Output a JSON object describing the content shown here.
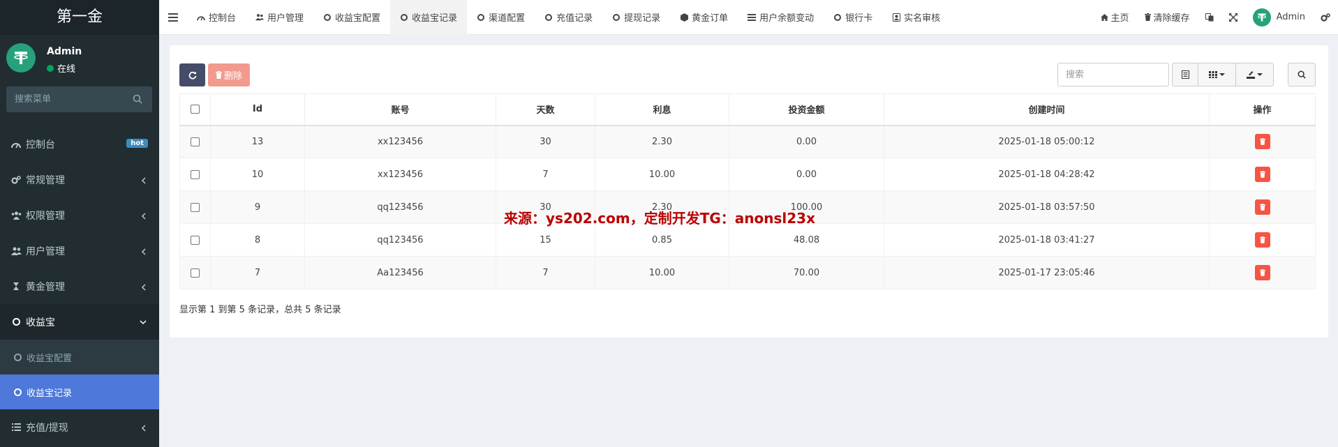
{
  "brand": {
    "title": "第一金",
    "accent": "#4e78d9",
    "sidebar_bg": "#222d32"
  },
  "user": {
    "name": "Admin",
    "status": "在线"
  },
  "menu_search": {
    "placeholder": "搜索菜单"
  },
  "sidebar": {
    "items": [
      {
        "label": "控制台",
        "icon": "dashboard-icon",
        "badge": "hot"
      },
      {
        "label": "常规管理",
        "icon": "cogs-icon"
      },
      {
        "label": "权限管理",
        "icon": "group-icon"
      },
      {
        "label": "用户管理",
        "icon": "users-icon"
      },
      {
        "label": "黄金管理",
        "icon": "hourglass-icon"
      },
      {
        "label": "收益宝",
        "icon": "circle-o-icon",
        "expanded": true,
        "children": [
          {
            "label": "收益宝配置",
            "active": false
          },
          {
            "label": "收益宝记录",
            "active": true
          }
        ]
      },
      {
        "label": "充值/提现",
        "icon": "list-icon"
      }
    ]
  },
  "tabs": [
    {
      "label": "控制台",
      "icon": "dashboard-icon"
    },
    {
      "label": "用户管理",
      "icon": "users-icon"
    },
    {
      "label": "收益宝配置",
      "icon": "circle-o-icon"
    },
    {
      "label": "收益宝记录",
      "icon": "circle-o-icon",
      "active": true
    },
    {
      "label": "渠道配置",
      "icon": "circle-o-icon"
    },
    {
      "label": "充值记录",
      "icon": "circle-o-icon"
    },
    {
      "label": "提现记录",
      "icon": "circle-o-icon"
    },
    {
      "label": "黄金订单",
      "icon": "cube-icon"
    },
    {
      "label": "用户余额变动",
      "icon": "list-icon"
    },
    {
      "label": "银行卡",
      "icon": "circle-o-icon"
    },
    {
      "label": "实名审核",
      "icon": "id-card-icon"
    }
  ],
  "topbar_right": {
    "home": "主页",
    "clear_cache": "清除缓存",
    "admin": "Admin"
  },
  "toolbar": {
    "delete_label": "删除",
    "search_placeholder": "搜索"
  },
  "table": {
    "columns": [
      "Id",
      "账号",
      "天数",
      "利息",
      "投资金额",
      "创建时间",
      "操作"
    ],
    "rows": [
      {
        "id": "13",
        "account": "xx123456",
        "days": "30",
        "interest": "2.30",
        "amount": "0.00",
        "created": "2025-01-18 05:00:12"
      },
      {
        "id": "10",
        "account": "xx123456",
        "days": "7",
        "interest": "10.00",
        "amount": "0.00",
        "created": "2025-01-18 04:28:42"
      },
      {
        "id": "9",
        "account": "qq123456",
        "days": "30",
        "interest": "2.30",
        "amount": "100.00",
        "created": "2025-01-18 03:57:50"
      },
      {
        "id": "8",
        "account": "qq123456",
        "days": "15",
        "interest": "0.85",
        "amount": "48.08",
        "created": "2025-01-18 03:41:27"
      },
      {
        "id": "7",
        "account": "Aa123456",
        "days": "7",
        "interest": "10.00",
        "amount": "70.00",
        "created": "2025-01-17 23:05:46"
      }
    ]
  },
  "pagination": {
    "summary": "显示第 1 到第 5 条记录，总共 5 条记录"
  },
  "watermark": "来源：ys202.com，定制开发TG：anonsl23x"
}
